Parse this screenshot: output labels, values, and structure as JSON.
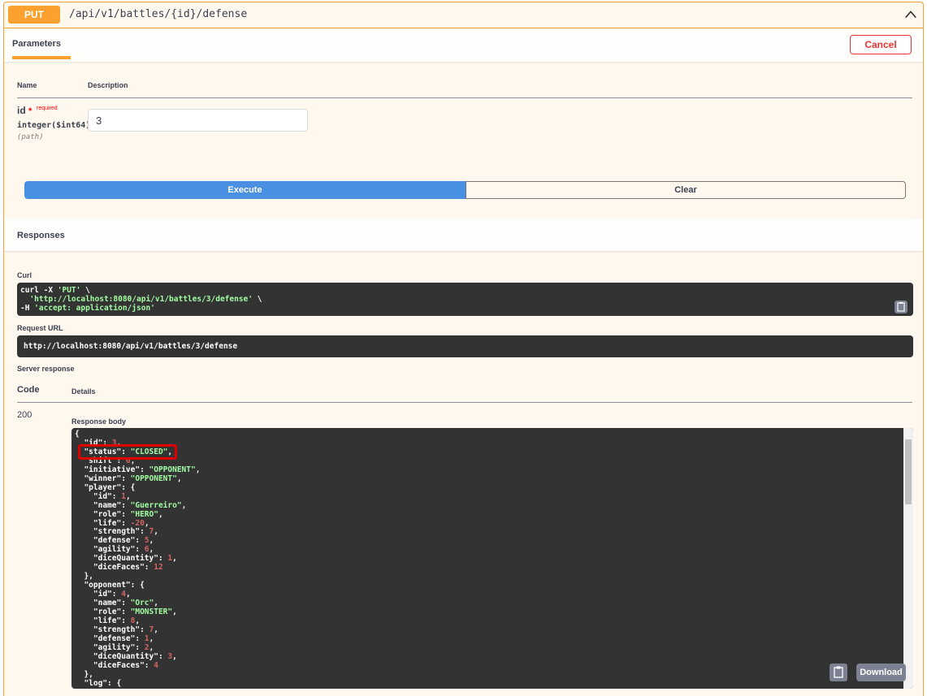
{
  "operation": {
    "method": "PUT",
    "path": "/api/v1/battles/{id}/defense"
  },
  "parameters": {
    "tab": "Parameters",
    "cancel": "Cancel",
    "col_name": "Name",
    "col_description": "Description",
    "param": {
      "name": "id",
      "star": "*",
      "required": "required",
      "type": "integer($int64)",
      "location": "(path)",
      "value": "3"
    }
  },
  "actions": {
    "execute": "Execute",
    "clear": "Clear"
  },
  "responses": {
    "title": "Responses",
    "curl_label": "Curl",
    "curl": {
      "line1": "curl -X ",
      "method": "'PUT'",
      "bs": " \\",
      "url": "'http://localhost:8080/api/v1/battles/3/defense'",
      "h": "  -H ",
      "header": "'accept: application/json'"
    },
    "request_url_label": "Request URL",
    "request_url": "http://localhost:8080/api/v1/battles/3/defense",
    "server_response_label": "Server response",
    "col_code": "Code",
    "col_details": "Details",
    "code": "200",
    "body_label": "Response body",
    "download": "Download"
  }
}
